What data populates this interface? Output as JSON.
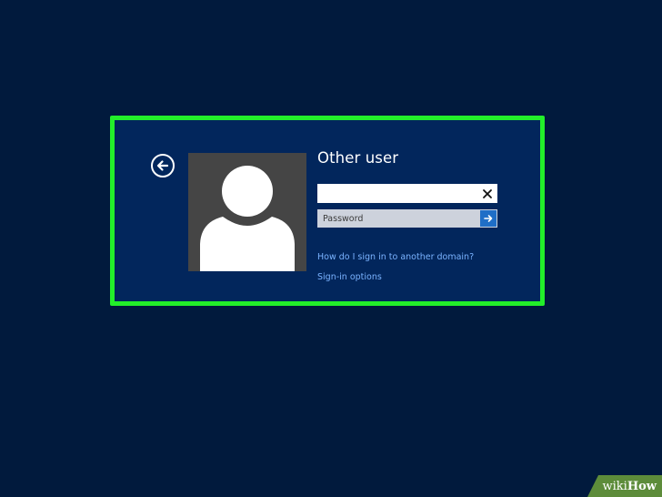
{
  "login": {
    "title": "Other user",
    "username_value": "",
    "password_placeholder": "Password",
    "link_domain": "How do I sign in to another domain?",
    "link_options": "Sign-in options"
  },
  "icons": {
    "back": "back-arrow-icon",
    "clear": "close-icon",
    "submit": "arrow-right-icon",
    "avatar": "user-silhouette-icon"
  },
  "watermark": {
    "wiki": "wiki",
    "how": "How"
  },
  "colors": {
    "background": "#011a3d",
    "panel": "#02265c",
    "highlight": "#23ef2a",
    "link": "#7ab3ff",
    "submit": "#1f6ec7",
    "avatar_bg": "#454545"
  }
}
